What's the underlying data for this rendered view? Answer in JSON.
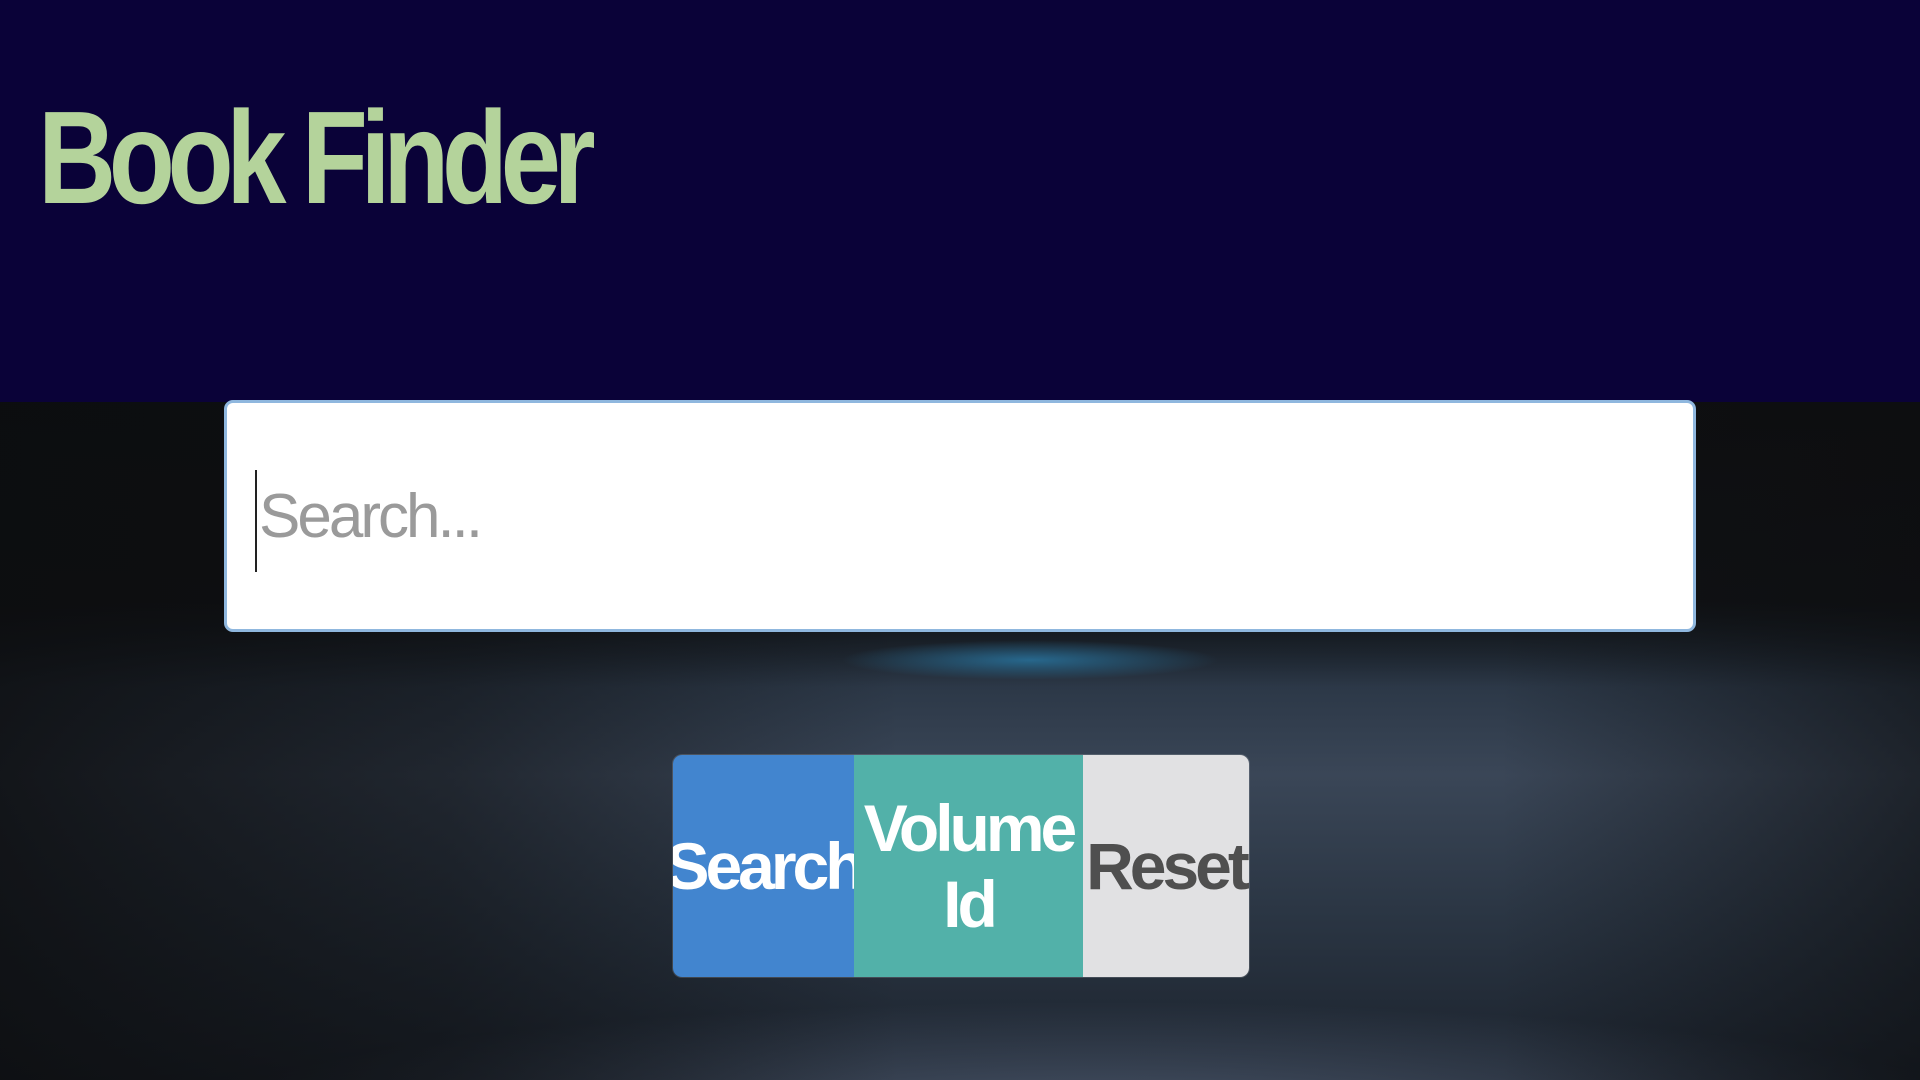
{
  "header": {
    "title": "Book Finder"
  },
  "search": {
    "placeholder": "Search...",
    "value": ""
  },
  "actions": {
    "search_label": "Search",
    "volume_id_label": "Volume Id",
    "reset_label": "Reset"
  },
  "colors": {
    "header_bg": "#0a0238",
    "title": "#b4d39b",
    "search_button": "#4285cf",
    "volume_id_button": "#52b1a9",
    "reset_button": "#e1e1e3",
    "input_border": "#8fb7de"
  }
}
